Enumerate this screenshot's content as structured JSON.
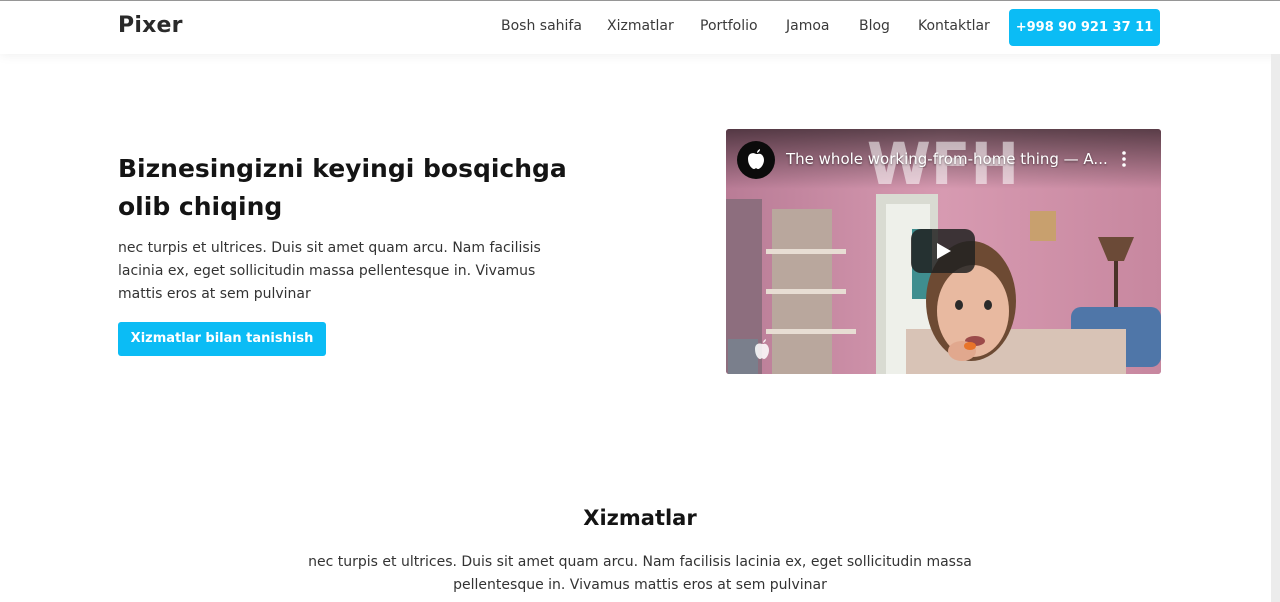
{
  "header": {
    "logo": "Pixer",
    "nav": [
      "Bosh sahifa",
      "Xizmatlar",
      "Portfolio",
      "Jamoa",
      "Blog",
      "Kontaktlar"
    ],
    "phone": "+998 90 921 37 11"
  },
  "hero": {
    "title": "Biznesingizni keyingi bosqichga olib chiqing",
    "text": "nec turpis et ultrices. Duis sit amet quam arcu. Nam facilisis lacinia ex, eget sollicitudin massa pellentesque in. Vivamus mattis eros at sem pulvinar",
    "cta": "Xizmatlar bilan tanishish"
  },
  "video": {
    "title": "The whole working-from-home thing — A...",
    "overlay_text": "WFH",
    "icons": [
      "apple-logo-icon",
      "more-options-icon",
      "play-icon",
      "apple-watermark-icon"
    ],
    "colors": {
      "wall": "#c98aa3",
      "play_bg": "#212121"
    }
  },
  "services": {
    "title": "Xizmatlar",
    "text": "nec turpis et ultrices. Duis sit amet quam arcu. Nam facilisis lacinia ex, eget sollicitudin massa pellentesque in. Vivamus mattis eros at sem pulvinar"
  },
  "colors": {
    "accent": "#0bbcf5",
    "text": "#141414"
  }
}
